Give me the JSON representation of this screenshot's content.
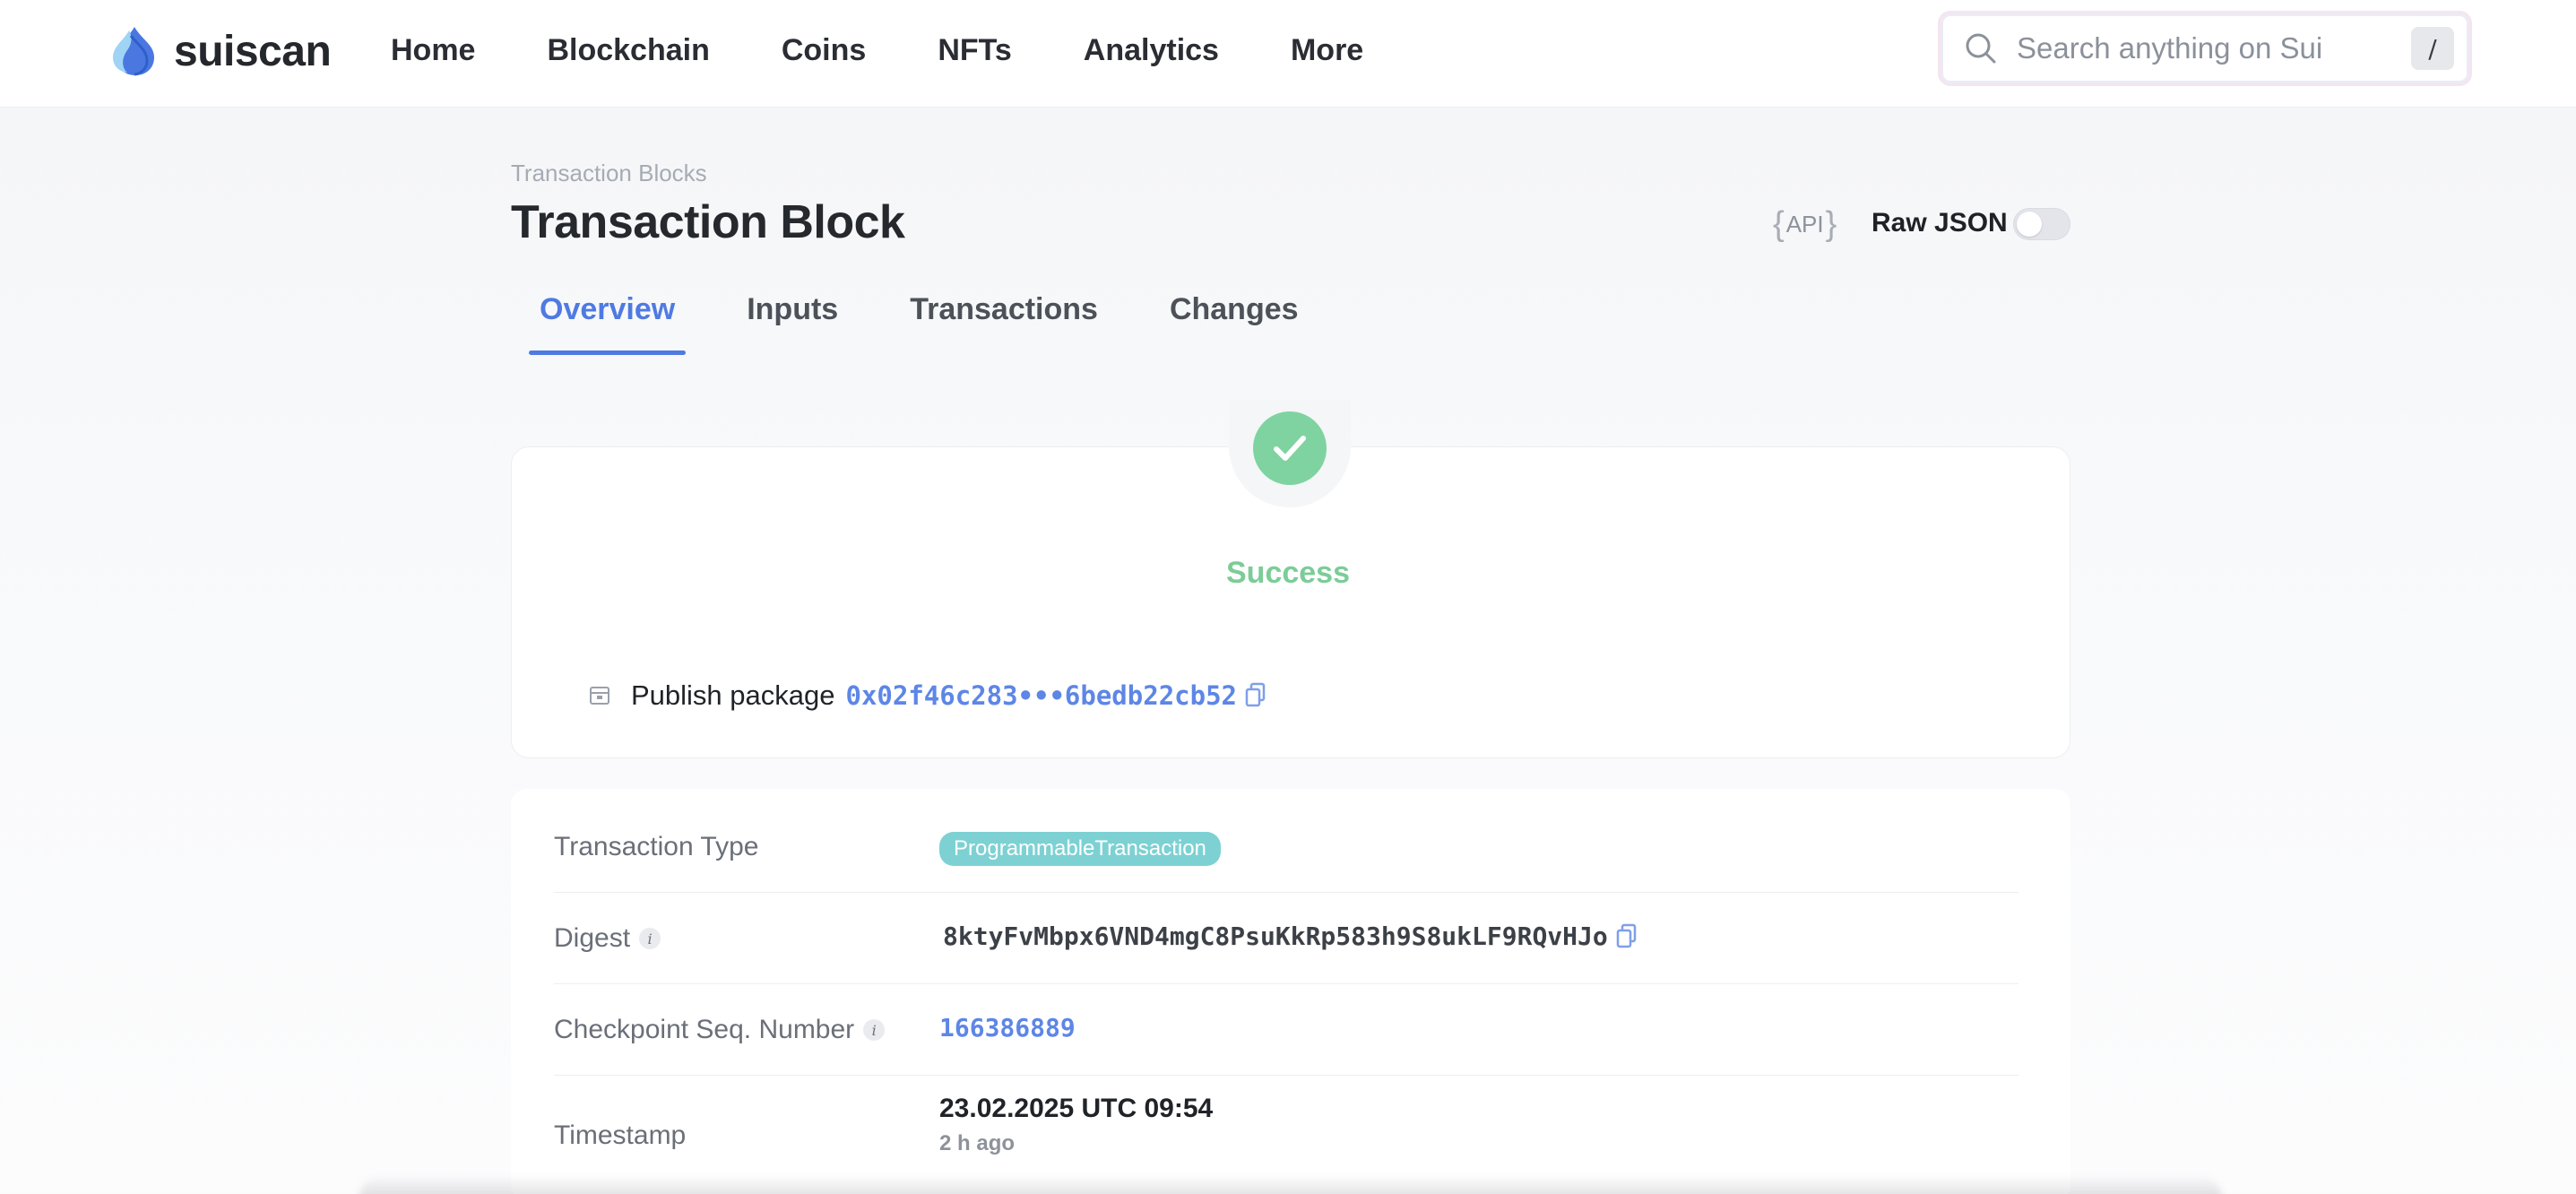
{
  "app": {
    "logo_text": "suiscan",
    "nav": [
      {
        "label": "Home"
      },
      {
        "label": "Blockchain"
      },
      {
        "label": "Coins"
      },
      {
        "label": "NFTs"
      },
      {
        "label": "Analytics"
      },
      {
        "label": "More"
      }
    ],
    "search": {
      "placeholder": "Search anything on Sui",
      "shortcut": "/"
    }
  },
  "header": {
    "breadcrumb": "Transaction Blocks",
    "title": "Transaction Block",
    "api_label": "API",
    "raw_json_label": "Raw JSON",
    "raw_json_enabled": false
  },
  "tabs": [
    {
      "label": "Overview",
      "active": true
    },
    {
      "label": "Inputs",
      "active": false
    },
    {
      "label": "Transactions",
      "active": false
    },
    {
      "label": "Changes",
      "active": false
    }
  ],
  "status": {
    "text": "Success",
    "package_action": "Publish package",
    "package_address": "0x02f46c283•••6bedb22cb52"
  },
  "details": {
    "transaction_type": {
      "label": "Transaction Type",
      "value": "ProgrammableTransaction"
    },
    "digest": {
      "label": "Digest",
      "value": "8ktyFvMbpx6VND4mgC8PsuKkRp583h9S8ukLF9RQvHJo"
    },
    "checkpoint": {
      "label": "Checkpoint Seq. Number",
      "value": "166386889"
    },
    "timestamp": {
      "label": "Timestamp",
      "value": "23.02.2025 UTC 09:54",
      "relative": "2 h ago"
    }
  },
  "colors": {
    "accent": "#4f7ae3",
    "success": "#7fd3a0",
    "badge": "#7dd1d3"
  },
  "icons": [
    "sui-logo-icon",
    "search-icon",
    "check-icon",
    "package-icon",
    "copy-icon",
    "info-icon"
  ]
}
